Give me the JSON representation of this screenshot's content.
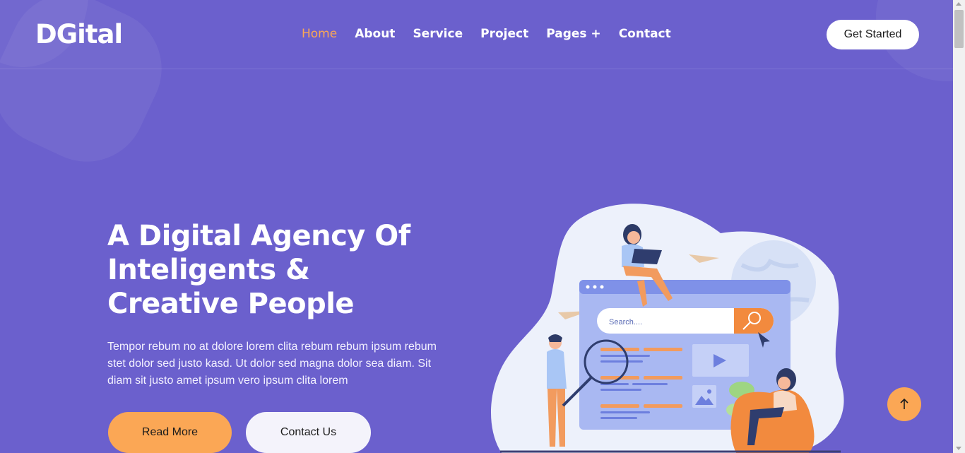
{
  "brand": {
    "logo": "DGital"
  },
  "nav": {
    "items": [
      {
        "label": "Home",
        "active": true
      },
      {
        "label": "About"
      },
      {
        "label": "Service"
      },
      {
        "label": "Project"
      },
      {
        "label": "Pages +"
      },
      {
        "label": "Contact"
      }
    ]
  },
  "header": {
    "cta_label": "Get Started"
  },
  "hero": {
    "title": "A Digital Agency Of Inteligents & Creative People",
    "text": "Tempor rebum no at dolore lorem clita rebum rebum ipsum rebum stet dolor sed justo kasd. Ut dolor sed magna dolor sea diam. Sit diam sit justo amet ipsum vero ipsum clita lorem",
    "read_more_label": "Read More",
    "contact_label": "Contact Us"
  },
  "illustration": {
    "search_placeholder": "Search...."
  },
  "colors": {
    "background": "#6b60cd",
    "accent": "#fba755",
    "white": "#ffffff"
  },
  "icons": {
    "back_to_top": "arrow-up-icon"
  }
}
